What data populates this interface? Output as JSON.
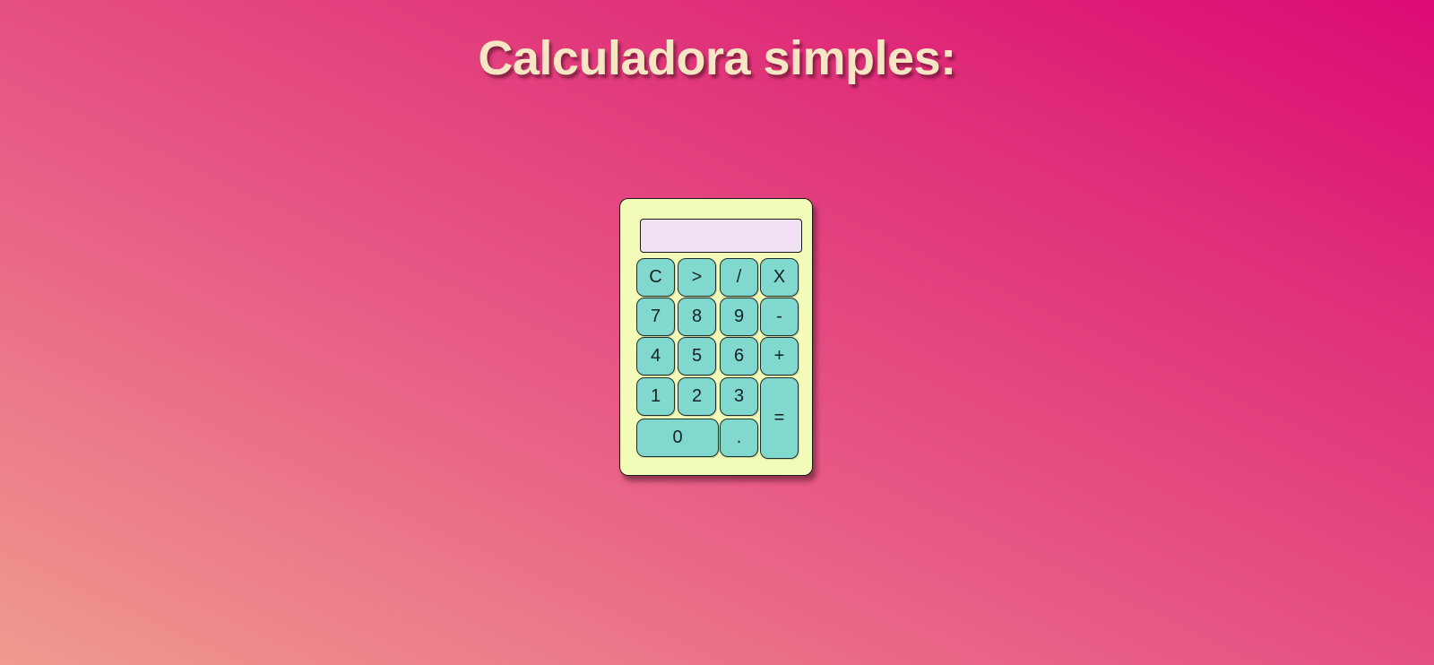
{
  "page": {
    "title": "Calculadora simples:"
  },
  "calculator": {
    "display_value": "",
    "keys": {
      "clear": "C",
      "backspace": ">",
      "divide": "/",
      "multiply": "X",
      "seven": "7",
      "eight": "8",
      "nine": "9",
      "minus": "-",
      "four": "4",
      "five": "5",
      "six": "6",
      "plus": "+",
      "one": "1",
      "two": "2",
      "three": "3",
      "equals": "=",
      "zero": "0",
      "decimal": "."
    }
  },
  "colors": {
    "background_start": "#f09a8e",
    "background_end": "#dc0a74",
    "title_text": "#f7e6c4",
    "calculator_body": "#f2fbb8",
    "display": "#f0e2f2",
    "key": "#80d8cf"
  }
}
